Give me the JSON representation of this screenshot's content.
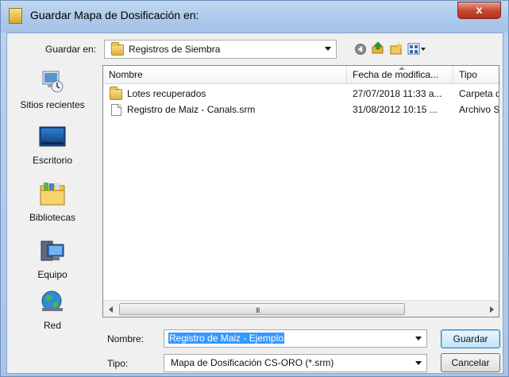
{
  "window": {
    "title": "Guardar Mapa de Dosificación en:",
    "close_glyph": "x"
  },
  "toolbar": {
    "save_in_label": "Guardar en:",
    "save_in_value": "Registros de Siembra",
    "icons": [
      "back-icon",
      "up-folder-icon",
      "new-folder-icon",
      "views-menu-icon"
    ]
  },
  "places": [
    {
      "name": "recent",
      "label": "Sitios recientes",
      "icon": "recent-places-icon"
    },
    {
      "name": "desktop",
      "label": "Escritorio",
      "icon": "desktop-icon"
    },
    {
      "name": "libraries",
      "label": "Bibliotecas",
      "icon": "libraries-icon"
    },
    {
      "name": "computer",
      "label": "Equipo",
      "icon": "computer-icon"
    },
    {
      "name": "network",
      "label": "Red",
      "icon": "network-icon"
    }
  ],
  "filelist": {
    "columns": [
      "Nombre",
      "Fecha de modifica...",
      "Tipo"
    ],
    "rows": [
      {
        "name": "Lotes recuperados",
        "date": "27/07/2018 11:33 a...",
        "type": "Carpeta d",
        "icon": "folder-icon"
      },
      {
        "name": "Registro de Maiz - Canals.srm",
        "date": "31/08/2012 10:15 ...",
        "type": "Archivo Sl",
        "icon": "file-icon"
      }
    ],
    "scroll_grip": "III"
  },
  "form": {
    "name_label": "Nombre:",
    "name_value": "Registro de Maiz - Ejemplo",
    "type_label": "Tipo:",
    "type_value": "Mapa de Dosificación CS-ORO (*.srm)"
  },
  "buttons": {
    "save": "Guardar",
    "cancel": "Cancelar"
  },
  "colors": {
    "selection": "#3399ff",
    "title_bar": "#aecaeb",
    "close_button": "#c74a35"
  }
}
